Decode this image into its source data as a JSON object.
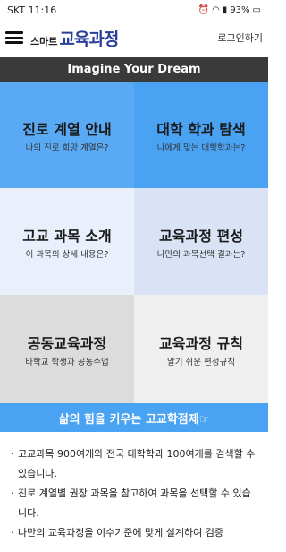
{
  "status_bar": {
    "time": "11:16",
    "carrier": "SKT",
    "battery": "93%",
    "icons": [
      "alarm-icon",
      "wifi-icon",
      "lte-icon",
      "signal-icon",
      "battery-icon"
    ]
  },
  "header": {
    "logo_small": "스마트",
    "logo_big": "교육과정",
    "login": "로그인하기"
  },
  "banner": "Imagine Your Dream",
  "tiles": [
    {
      "title": "진로 계열 안내",
      "subtitle": "나의 진로 희망 계열은?"
    },
    {
      "title": "대학 학과 탐색",
      "subtitle": "나에게 맞는 대학학과는?"
    },
    {
      "title": "고교 과목 소개",
      "subtitle": "이 과목의 상세 내용은?"
    },
    {
      "title": "교육과정 편성",
      "subtitle": "나만의 과목선택 결과는?"
    },
    {
      "title": "공동교육과정",
      "subtitle": "타학교 학생과 공동수업"
    },
    {
      "title": "교육과정 규칙",
      "subtitle": "알기 쉬운 편성규칙"
    }
  ],
  "slogan": "삶의 힘을 키우는 고교학점제☞",
  "description": [
    "고교과목 900여개와 전국 대학학과 100여개를 검색할 수 있습니다.",
    "진로 계열별 권장 과목을 참고하여 과목을 선택할 수 있습니다.",
    "나만의 교육과정을 이수기준에 맞게 설계하여 검증"
  ],
  "colors": {
    "accent": "#4aa2f2",
    "brand": "#2a3f9a",
    "banner": "#3a3a3a"
  }
}
